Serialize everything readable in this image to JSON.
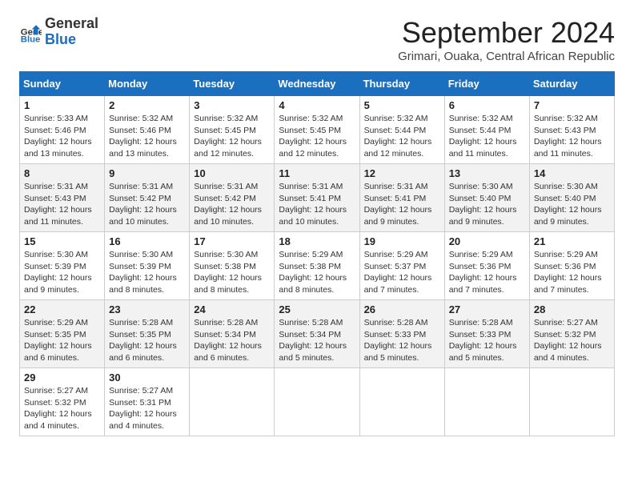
{
  "logo": {
    "general": "General",
    "blue": "Blue"
  },
  "header": {
    "month": "September 2024",
    "location": "Grimari, Ouaka, Central African Republic"
  },
  "days_of_week": [
    "Sunday",
    "Monday",
    "Tuesday",
    "Wednesday",
    "Thursday",
    "Friday",
    "Saturday"
  ],
  "weeks": [
    [
      {
        "day": "1",
        "sunrise": "5:33 AM",
        "sunset": "5:46 PM",
        "daylight": "12 hours and 13 minutes."
      },
      {
        "day": "2",
        "sunrise": "5:32 AM",
        "sunset": "5:46 PM",
        "daylight": "12 hours and 13 minutes."
      },
      {
        "day": "3",
        "sunrise": "5:32 AM",
        "sunset": "5:45 PM",
        "daylight": "12 hours and 12 minutes."
      },
      {
        "day": "4",
        "sunrise": "5:32 AM",
        "sunset": "5:45 PM",
        "daylight": "12 hours and 12 minutes."
      },
      {
        "day": "5",
        "sunrise": "5:32 AM",
        "sunset": "5:44 PM",
        "daylight": "12 hours and 12 minutes."
      },
      {
        "day": "6",
        "sunrise": "5:32 AM",
        "sunset": "5:44 PM",
        "daylight": "12 hours and 11 minutes."
      },
      {
        "day": "7",
        "sunrise": "5:32 AM",
        "sunset": "5:43 PM",
        "daylight": "12 hours and 11 minutes."
      }
    ],
    [
      {
        "day": "8",
        "sunrise": "5:31 AM",
        "sunset": "5:43 PM",
        "daylight": "12 hours and 11 minutes."
      },
      {
        "day": "9",
        "sunrise": "5:31 AM",
        "sunset": "5:42 PM",
        "daylight": "12 hours and 10 minutes."
      },
      {
        "day": "10",
        "sunrise": "5:31 AM",
        "sunset": "5:42 PM",
        "daylight": "12 hours and 10 minutes."
      },
      {
        "day": "11",
        "sunrise": "5:31 AM",
        "sunset": "5:41 PM",
        "daylight": "12 hours and 10 minutes."
      },
      {
        "day": "12",
        "sunrise": "5:31 AM",
        "sunset": "5:41 PM",
        "daylight": "12 hours and 9 minutes."
      },
      {
        "day": "13",
        "sunrise": "5:30 AM",
        "sunset": "5:40 PM",
        "daylight": "12 hours and 9 minutes."
      },
      {
        "day": "14",
        "sunrise": "5:30 AM",
        "sunset": "5:40 PM",
        "daylight": "12 hours and 9 minutes."
      }
    ],
    [
      {
        "day": "15",
        "sunrise": "5:30 AM",
        "sunset": "5:39 PM",
        "daylight": "12 hours and 9 minutes."
      },
      {
        "day": "16",
        "sunrise": "5:30 AM",
        "sunset": "5:39 PM",
        "daylight": "12 hours and 8 minutes."
      },
      {
        "day": "17",
        "sunrise": "5:30 AM",
        "sunset": "5:38 PM",
        "daylight": "12 hours and 8 minutes."
      },
      {
        "day": "18",
        "sunrise": "5:29 AM",
        "sunset": "5:38 PM",
        "daylight": "12 hours and 8 minutes."
      },
      {
        "day": "19",
        "sunrise": "5:29 AM",
        "sunset": "5:37 PM",
        "daylight": "12 hours and 7 minutes."
      },
      {
        "day": "20",
        "sunrise": "5:29 AM",
        "sunset": "5:36 PM",
        "daylight": "12 hours and 7 minutes."
      },
      {
        "day": "21",
        "sunrise": "5:29 AM",
        "sunset": "5:36 PM",
        "daylight": "12 hours and 7 minutes."
      }
    ],
    [
      {
        "day": "22",
        "sunrise": "5:29 AM",
        "sunset": "5:35 PM",
        "daylight": "12 hours and 6 minutes."
      },
      {
        "day": "23",
        "sunrise": "5:28 AM",
        "sunset": "5:35 PM",
        "daylight": "12 hours and 6 minutes."
      },
      {
        "day": "24",
        "sunrise": "5:28 AM",
        "sunset": "5:34 PM",
        "daylight": "12 hours and 6 minutes."
      },
      {
        "day": "25",
        "sunrise": "5:28 AM",
        "sunset": "5:34 PM",
        "daylight": "12 hours and 5 minutes."
      },
      {
        "day": "26",
        "sunrise": "5:28 AM",
        "sunset": "5:33 PM",
        "daylight": "12 hours and 5 minutes."
      },
      {
        "day": "27",
        "sunrise": "5:28 AM",
        "sunset": "5:33 PM",
        "daylight": "12 hours and 5 minutes."
      },
      {
        "day": "28",
        "sunrise": "5:27 AM",
        "sunset": "5:32 PM",
        "daylight": "12 hours and 4 minutes."
      }
    ],
    [
      {
        "day": "29",
        "sunrise": "5:27 AM",
        "sunset": "5:32 PM",
        "daylight": "12 hours and 4 minutes."
      },
      {
        "day": "30",
        "sunrise": "5:27 AM",
        "sunset": "5:31 PM",
        "daylight": "12 hours and 4 minutes."
      },
      null,
      null,
      null,
      null,
      null
    ]
  ]
}
